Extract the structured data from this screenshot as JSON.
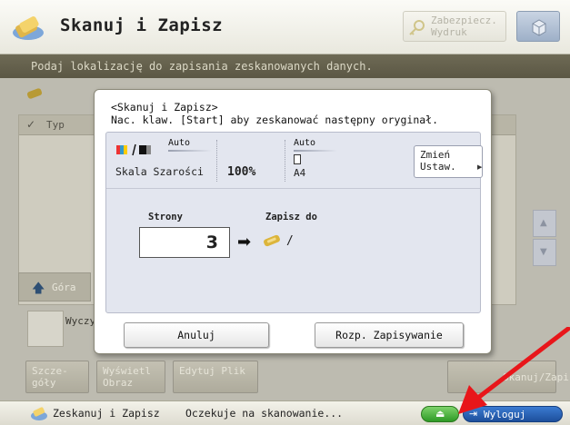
{
  "header": {
    "title": "Skanuj i Zapisz",
    "secure_print_label": "Zabezpiecz. Wydruk"
  },
  "instruction": "Podaj lokalizację do zapisania zeskanowanych danych.",
  "background": {
    "list_header_type": "Typ",
    "up_button_label": "Góra",
    "clear_selection_label": "Wyczyść Wybór",
    "buttons": [
      "Szcze-góły",
      "Wyświetl Obraz",
      "Edytuj Plik"
    ],
    "save_button_label": "Skanuj/Zapisz"
  },
  "dialog": {
    "message_line1": "<Skanuj i Zapisz>",
    "message_line2": "Nac. klaw. [Start] aby zeskanować następny oryginał.",
    "color_auto": "Auto",
    "color_mode": "Skala Szarości",
    "scale": "100%",
    "paper_auto": "Auto",
    "paper_size": "A4",
    "change_settings_label": "Zmień Ustaw.",
    "pages_label": "Strony",
    "pages_value": "3",
    "save_to_label": "Zapisz do",
    "save_path": "/",
    "cancel_label": "Anuluj",
    "start_saving_label": "Rozp. Zapisywanie"
  },
  "status_bar": {
    "app_name": "Zeskanuj i Zapisz",
    "status_text": "Oczekuje na skanowanie...",
    "logout_label": "Wyloguj"
  },
  "colors": {
    "instruction_bar": "#5b5744",
    "annotation_arrow": "#e8161a",
    "eject_button": "#2f9a26",
    "logout_button": "#1d4f9c"
  }
}
